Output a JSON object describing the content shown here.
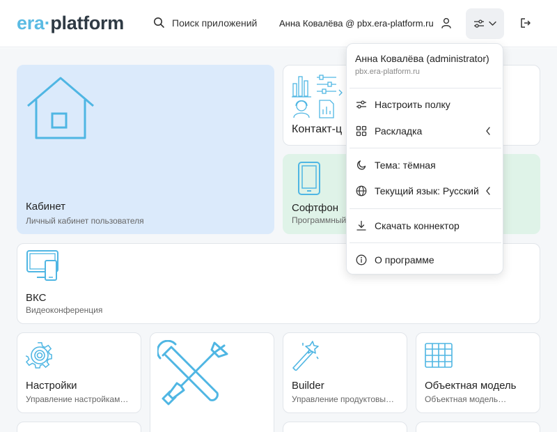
{
  "header": {
    "logo_era": "era",
    "logo_dot": "·",
    "logo_platform": "platform",
    "search_label": "Поиск приложений",
    "user_line": "Анна Ковалёва @ pbx.era-platform.ru"
  },
  "tiles": {
    "cabinet": {
      "title": "Кабинет",
      "subtitle": "Личный кабинет пользователя"
    },
    "contact": {
      "title": "Контакт-ц"
    },
    "softphone": {
      "title": "Софтфон",
      "subtitle": "Программный"
    },
    "vks": {
      "title": "ВКС",
      "subtitle": "Видеоконференция"
    },
    "settings": {
      "title": "Настройки",
      "subtitle": "Управление настройкам…"
    },
    "builder": {
      "title": "Builder",
      "subtitle": "Управление продуктовы…"
    },
    "object_model": {
      "title": "Объектная модель",
      "subtitle": "Объектная модель…"
    }
  },
  "menu": {
    "name": "Анна Ковалёва (administrator)",
    "host": "pbx.era-platform.ru",
    "items": [
      {
        "label": "Настроить полку",
        "icon": "sliders-icon"
      },
      {
        "label": "Раскладка",
        "icon": "grid-icon",
        "submenu": true
      },
      {
        "label": "Тема: тёмная",
        "icon": "moon-icon"
      },
      {
        "label": "Текущий язык: Русский",
        "icon": "globe-icon",
        "submenu": true
      },
      {
        "label": "Скачать коннектор",
        "icon": "download-icon"
      },
      {
        "label": "О программе",
        "icon": "info-icon"
      }
    ]
  },
  "colors": {
    "accent": "#5bbbe3",
    "cabinet_bg": "#dbeafb",
    "softphone_bg": "#dff3e8",
    "icon_stroke": "#4fb6e3"
  }
}
